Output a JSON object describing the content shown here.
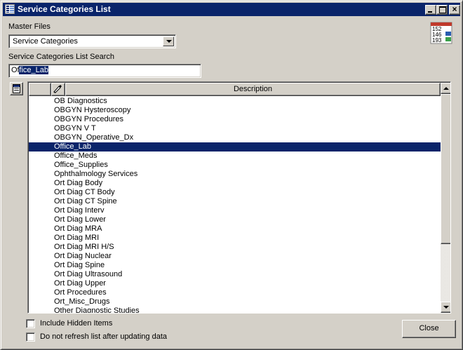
{
  "window": {
    "title": "Service Categories List"
  },
  "master_files": {
    "label": "Master Files",
    "selected": "Service Categories"
  },
  "search": {
    "label": "Service Categories List Search",
    "value_prefix": "Of",
    "value_selected": "fice_Lab"
  },
  "corner_icon": {
    "lines": [
      "152",
      "146",
      "193"
    ]
  },
  "table": {
    "column_description": "Description",
    "rows": [
      "OB Diagnostics",
      "OBGYN Hysteroscopy",
      "OBGYN Procedures",
      "OBGYN V T",
      "OBGYN_Operative_Dx",
      "Office_Lab",
      "Office_Meds",
      "Office_Supplies",
      "Ophthalmology Services",
      "Ort Diag Body",
      "Ort Diag CT Body",
      "Ort Diag CT Spine",
      "Ort Diag Interv",
      "Ort Diag Lower",
      "Ort Diag MRA",
      "Ort Diag MRI",
      "Ort Diag MRI H/S",
      "Ort Diag Nuclear",
      "Ort Diag Spine",
      "Ort Diag Ultrasound",
      "Ort Diag Upper",
      "Ort Procedures",
      "Ort_Misc_Drugs",
      "Other Diagnostic Studies"
    ],
    "selected_row": "Office_Lab"
  },
  "options": {
    "include_hidden": "Include Hidden Items",
    "no_refresh": "Do not refresh list after updating data"
  },
  "buttons": {
    "close": "Close"
  },
  "colors": {
    "selection": "#0a246a",
    "face": "#d4d0c8"
  }
}
